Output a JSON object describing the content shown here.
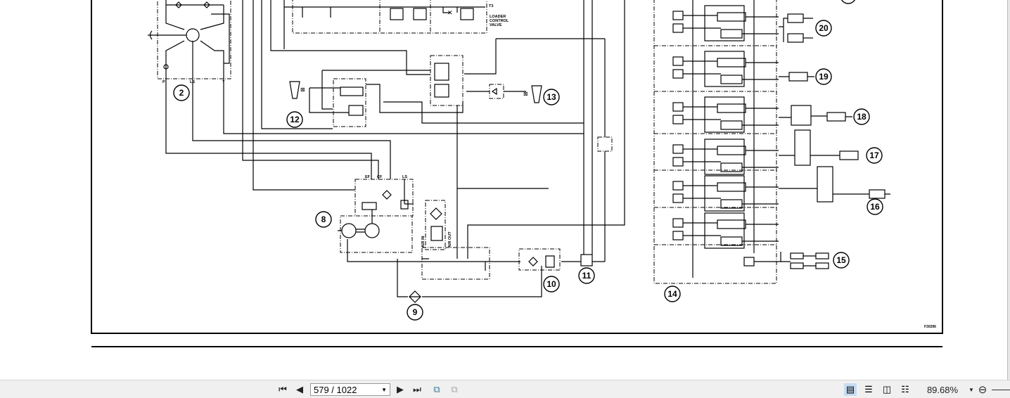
{
  "document": {
    "figure_id": "F30296",
    "loader_valve_label": [
      "LOADER",
      "CONTROL",
      "VALVE"
    ],
    "port_labels": {
      "t3": "T3",
      "p": "P",
      "ls": "LS",
      "t": "T",
      "ef": "EF",
      "cf": "CF",
      "ls2": "LS"
    },
    "air_in_label": "AIR IN",
    "air_out_label": "AIR OUT",
    "callouts": {
      "c2": "2",
      "c8": "8",
      "c9": "9",
      "c10": "10",
      "c11": "11",
      "c12": "12",
      "c13": "13",
      "c14": "14",
      "c15": "15",
      "c16": "16",
      "c17": "17",
      "c18": "18",
      "c19": "19",
      "c20": "20"
    }
  },
  "toolbar": {
    "first_page_icon": "first-page-icon",
    "prev_page_icon": "prev-page-icon",
    "page_value": "579 / 1022",
    "next_page_icon": "next-page-icon",
    "last_page_icon": "last-page-icon",
    "zoom_value": "89.68%",
    "active_view_mode": "single-page"
  }
}
